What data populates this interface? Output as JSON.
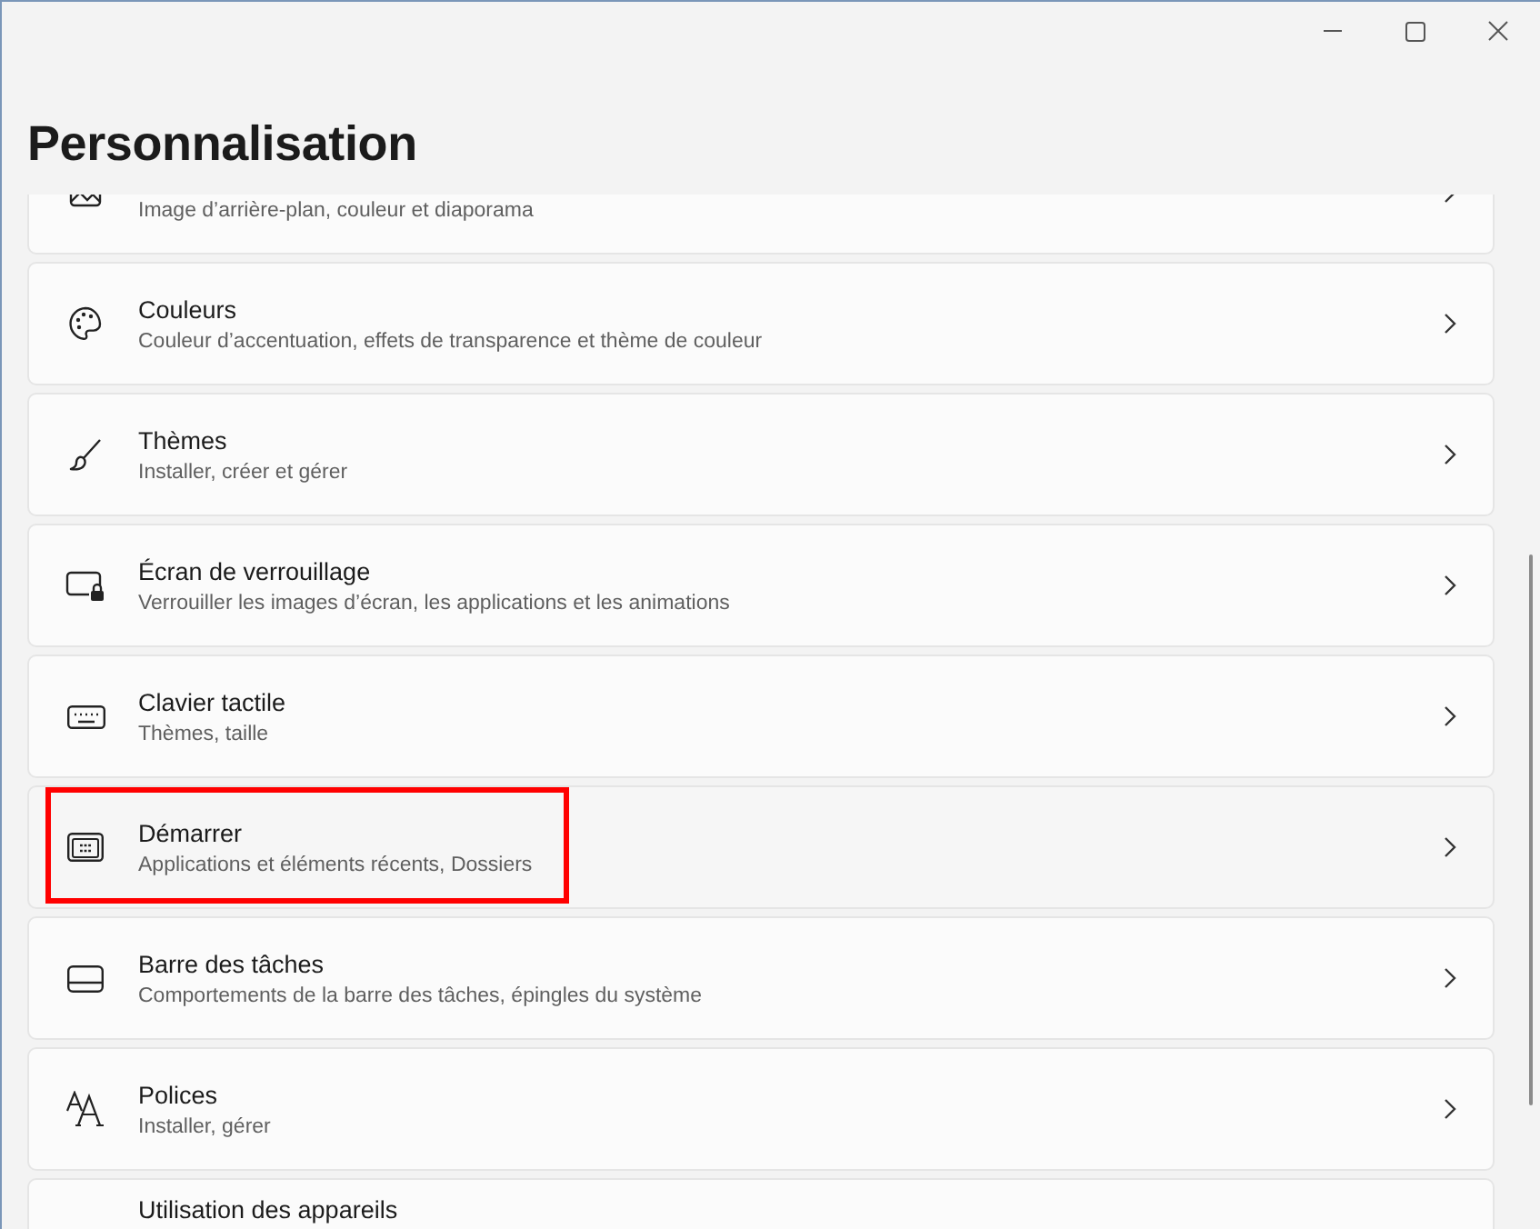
{
  "window": {
    "title": "Personnalisation"
  },
  "items": [
    {
      "kind": "picture",
      "subtitle": "Image d’arrière-plan, couleur et diaporama",
      "highlighted": false
    },
    {
      "kind": "palette",
      "title": "Couleurs",
      "subtitle": "Couleur d’accentuation, effets de transparence et thème de couleur",
      "highlighted": false
    },
    {
      "kind": "brush",
      "title": "Thèmes",
      "subtitle": "Installer, créer et gérer",
      "highlighted": false
    },
    {
      "kind": "lockscreen",
      "title": "Écran de verrouillage",
      "subtitle": "Verrouiller les images d’écran, les applications et les animations",
      "highlighted": false
    },
    {
      "kind": "keyboard",
      "title": "Clavier tactile",
      "subtitle": "Thèmes, taille",
      "highlighted": false
    },
    {
      "kind": "start",
      "title": "Démarrer",
      "subtitle": "Applications et éléments récents, Dossiers",
      "highlighted": true
    },
    {
      "kind": "taskbar",
      "title": "Barre des tâches",
      "subtitle": "Comportements de la barre des tâches, épingles du système",
      "highlighted": false
    },
    {
      "kind": "fonts",
      "title": "Polices",
      "subtitle": "Installer, gérer",
      "highlighted": false
    },
    {
      "kind": "device",
      "title": "Utilisation des appareils",
      "highlighted": false
    }
  ]
}
